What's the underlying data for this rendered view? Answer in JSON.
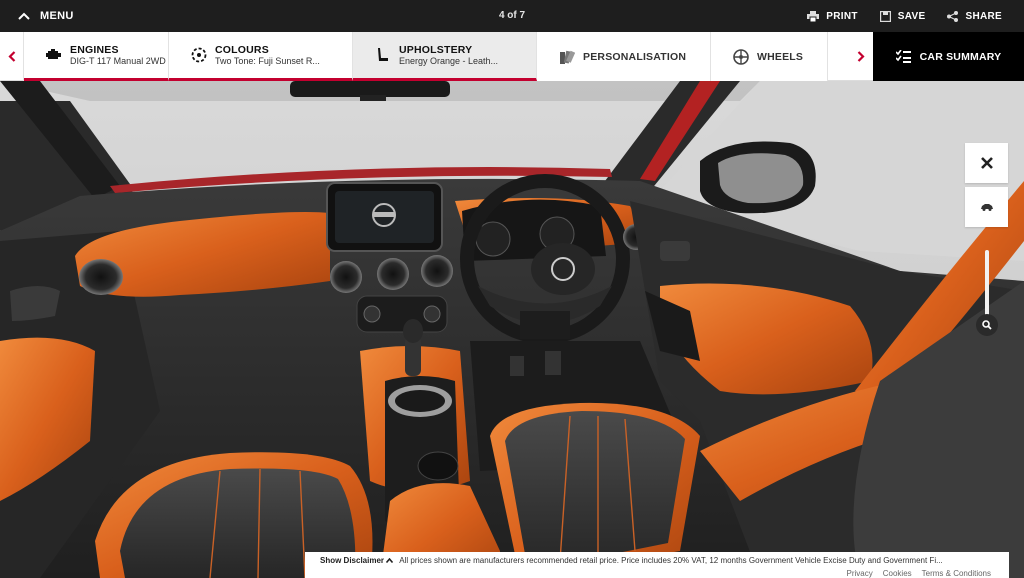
{
  "topbar": {
    "menu_label": "MENU",
    "pager": "4 of 7",
    "actions": [
      {
        "label": "PRINT",
        "icon": "printer-icon"
      },
      {
        "label": "SAVE",
        "icon": "save-icon"
      },
      {
        "label": "SHARE",
        "icon": "share-icon"
      }
    ]
  },
  "tabs": [
    {
      "label": "ENGINES",
      "sub": "DIG-T 117 Manual 2WD",
      "icon": "engine-icon"
    },
    {
      "label": "COLOURS",
      "sub": "Two Tone: Fuji Sunset R...",
      "icon": "palette-icon"
    },
    {
      "label": "UPHOLSTERY",
      "sub": "Energy Orange - Leath...",
      "icon": "seat-icon"
    },
    {
      "label": "PERSONALISATION",
      "icon": "swatch-icon"
    },
    {
      "label": "WHEELS",
      "icon": "wheel-icon"
    }
  ],
  "car_summary": "CAR SUMMARY",
  "viewer": {
    "close_icon": "close-icon",
    "exterior_icon": "car-icon",
    "zoom_icon": "zoom-icon"
  },
  "disclaimer": {
    "show_label": "Show Disclaimer",
    "text": "All prices shown are manufacturers recommended retail price. Price includes 20% VAT, 12 months Government Vehicle Excise Duty and Government Fi...",
    "links": [
      "Privacy",
      "Cookies",
      "Terms & Conditions"
    ]
  },
  "colors": {
    "accent": "#c3002f",
    "upholstery": "#e0651f",
    "dark": "#2b2b2b"
  }
}
